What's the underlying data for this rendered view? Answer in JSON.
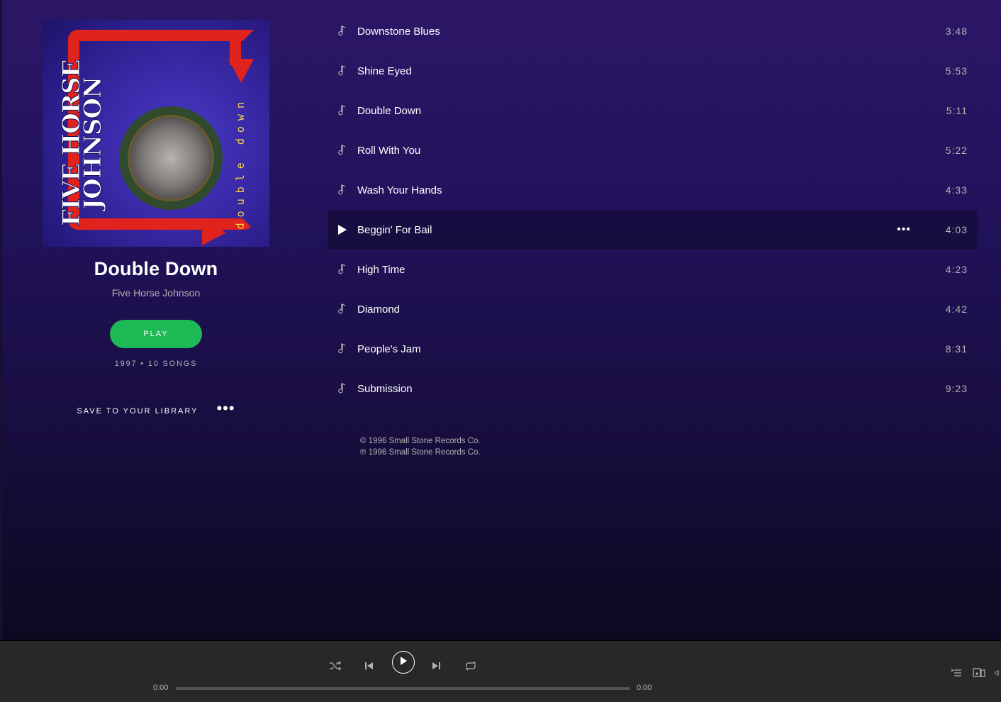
{
  "album": {
    "cover_title": "FIVE HORSE JOHNSON",
    "cover_subtitle": "double down",
    "title": "Double Down",
    "artist": "Five Horse Johnson",
    "play_label": "PLAY",
    "meta": "1997 • 10 SONGS",
    "save_label": "SAVE TO YOUR LIBRARY",
    "more_label": "•••"
  },
  "tracks": [
    {
      "name": "Downstone Blues",
      "duration": "3:48"
    },
    {
      "name": "Shine Eyed",
      "duration": "5:53"
    },
    {
      "name": "Double Down",
      "duration": "5:11"
    },
    {
      "name": "Roll With You",
      "duration": "5:22"
    },
    {
      "name": "Wash Your Hands",
      "duration": "4:33"
    },
    {
      "name": "Beggin' For Bail",
      "duration": "4:03",
      "active": true,
      "more": "•••"
    },
    {
      "name": "High Time",
      "duration": "4:23"
    },
    {
      "name": "Diamond",
      "duration": "4:42"
    },
    {
      "name": "People's Jam",
      "duration": "8:31"
    },
    {
      "name": "Submission",
      "duration": "9:23"
    }
  ],
  "copyright": {
    "line1": "© 1996 Small Stone Records Co.",
    "line2": "℗ 1996 Small Stone Records Co."
  },
  "player": {
    "elapsed": "0:00",
    "total": "0:00",
    "progress": 0,
    "icons": [
      "shuffle-icon",
      "previous-icon",
      "play-icon",
      "next-icon",
      "repeat-icon",
      "queue-icon",
      "devices-icon",
      "volume-icon"
    ]
  },
  "colors": {
    "accent": "#1db954",
    "background_top": "#2c1767",
    "player_bar": "#282828"
  }
}
